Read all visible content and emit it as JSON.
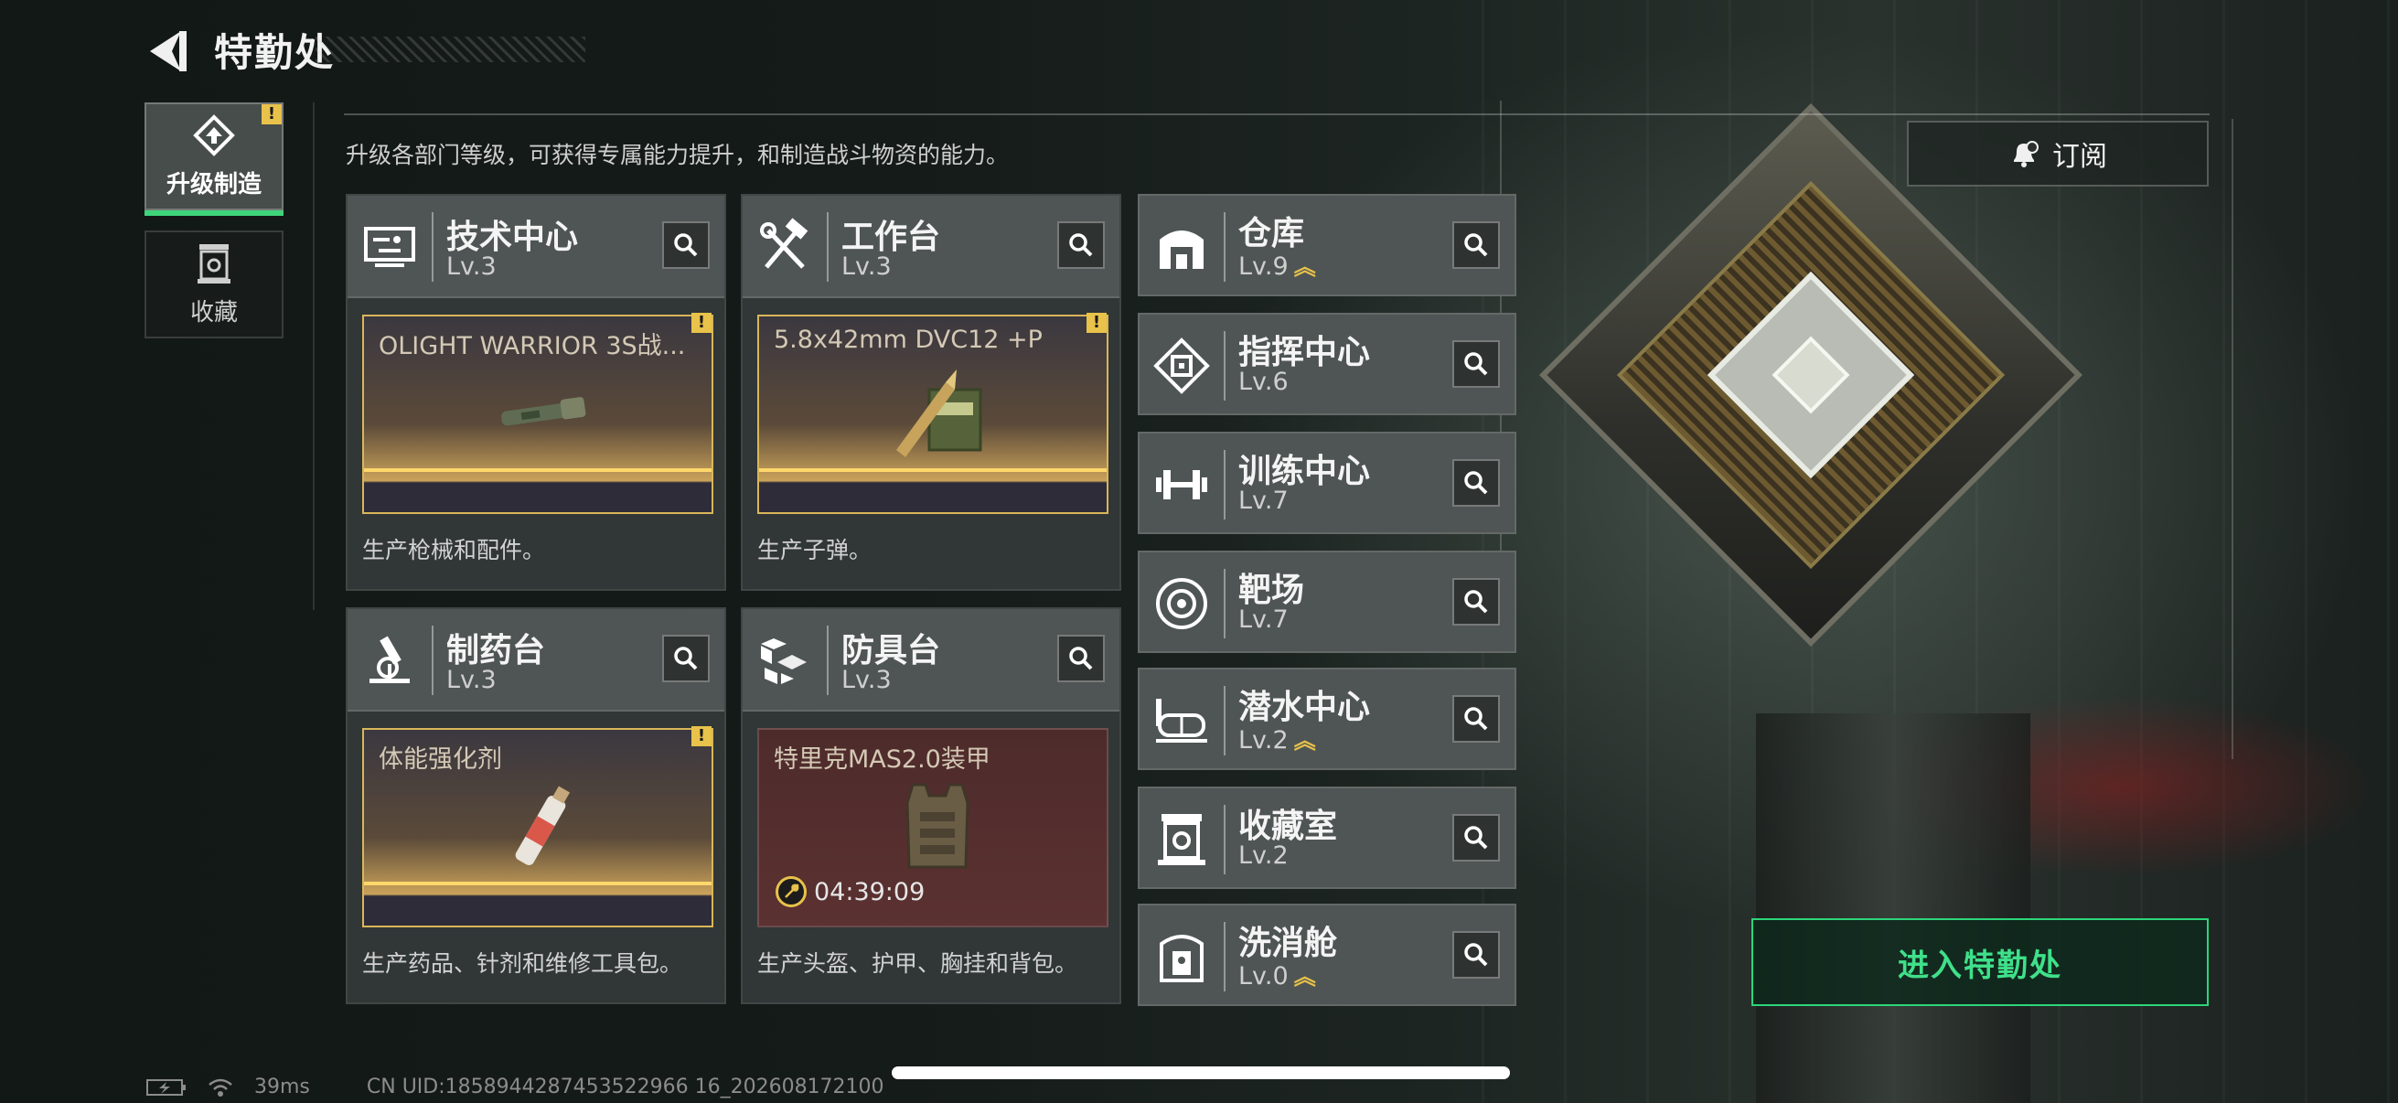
{
  "header": {
    "title": "特勤处"
  },
  "nav": [
    {
      "label": "升级制造",
      "icon": "upgrade-icon",
      "active": true,
      "warn": "!"
    },
    {
      "label": "收藏",
      "icon": "collection-icon",
      "active": false
    }
  ],
  "description": "升级各部门等级，可获得专属能力提升，和制造战斗物资的能力。",
  "subscribe_label": "订阅",
  "big_cards": [
    {
      "name": "技术中心",
      "level": "Lv.3",
      "icon": "tech-center-icon",
      "product": "OLIGHT WARRIOR 3S战...",
      "warn": "!",
      "desc": "生产枪械和配件。"
    },
    {
      "name": "工作台",
      "level": "Lv.3",
      "icon": "workbench-icon",
      "product": "5.8x42mm DVC12 +P",
      "warn": "!",
      "desc": "生产子弹。"
    },
    {
      "name": "制药台",
      "level": "Lv.3",
      "icon": "pharmacy-icon",
      "product": "体能强化剂",
      "warn": "!",
      "desc": "生产药品、针剂和维修工具包。"
    },
    {
      "name": "防具台",
      "level": "Lv.3",
      "icon": "armor-bench-icon",
      "product": "特里克MAS2.0装甲",
      "timer": "04:39:09",
      "desc": "生产头盔、护甲、胸挂和背包。"
    }
  ],
  "small_cards": [
    {
      "name": "仓库",
      "level": "Lv.9",
      "upgradable": true,
      "icon": "warehouse-icon"
    },
    {
      "name": "指挥中心",
      "level": "Lv.6",
      "upgradable": false,
      "icon": "command-center-icon"
    },
    {
      "name": "训练中心",
      "level": "Lv.7",
      "upgradable": false,
      "icon": "training-center-icon"
    },
    {
      "name": "靶场",
      "level": "Lv.7",
      "upgradable": false,
      "icon": "shooting-range-icon"
    },
    {
      "name": "潜水中心",
      "level": "Lv.2",
      "upgradable": true,
      "icon": "diving-center-icon"
    },
    {
      "name": "收藏室",
      "level": "Lv.2",
      "upgradable": false,
      "icon": "collection-room-icon"
    },
    {
      "name": "洗消舱",
      "level": "Lv.0",
      "upgradable": true,
      "icon": "decon-chamber-icon"
    }
  ],
  "enter_label": "进入特勤处",
  "status": {
    "ping": "39ms",
    "uid": "CN UID:1858944287453522966 16_202608172100"
  },
  "colors": {
    "accent": "#3ed47a",
    "warn": "#e8c24a",
    "gold": "#d9b65a"
  }
}
